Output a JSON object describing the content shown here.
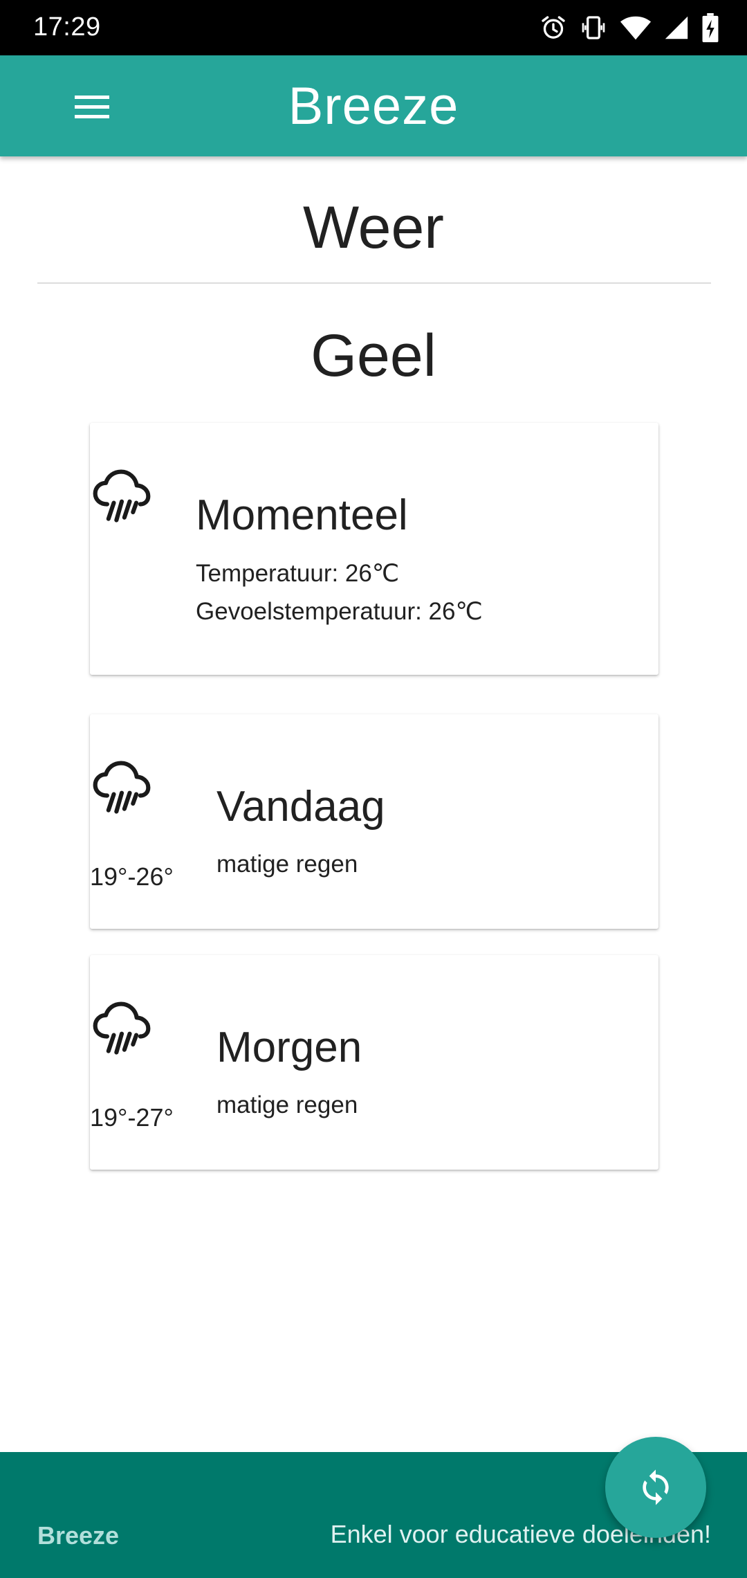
{
  "status_bar": {
    "time": "17:29",
    "icons": [
      "alarm-icon",
      "vibrate-icon",
      "wifi-icon",
      "signal-icon",
      "battery-charging-icon"
    ]
  },
  "app_bar": {
    "title": "Breeze",
    "menu_icon": "menu-icon"
  },
  "page": {
    "section_title": "Weer",
    "city": "Geel"
  },
  "cards": {
    "current": {
      "icon": "rain-cloud-icon",
      "heading": "Momenteel",
      "temperature": "Temperatuur: 26℃",
      "feels_like": "Gevoelstemperatuur: 26℃"
    },
    "today": {
      "icon": "rain-cloud-icon",
      "range": "19°-26°",
      "heading": "Vandaag",
      "description": "matige regen"
    },
    "tomorrow": {
      "icon": "rain-cloud-icon",
      "range": "19°-27°",
      "heading": "Morgen",
      "description": "matige regen"
    }
  },
  "footer": {
    "brand": "Breeze",
    "note": "Enkel voor educatieve doeleinden!"
  },
  "fab": {
    "icon": "refresh-icon"
  },
  "colors": {
    "primary": "#26a69a",
    "footer": "#00796b",
    "text": "#212121"
  }
}
